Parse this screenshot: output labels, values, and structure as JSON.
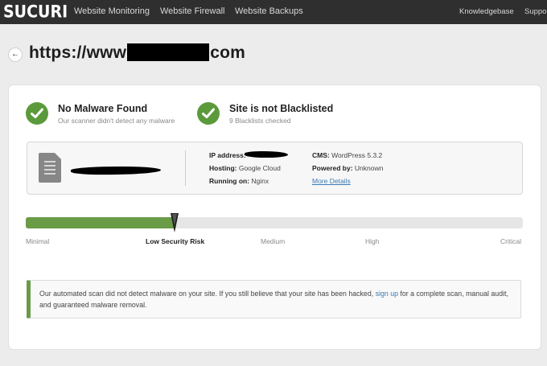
{
  "nav": {
    "logo": "SUCURI",
    "items": [
      "Website Monitoring",
      "Website Firewall",
      "Website Backups"
    ],
    "right_items": [
      "Knowledgebase",
      "Suppor"
    ]
  },
  "header": {
    "url_prefix": "https://www",
    "url_suffix": "com"
  },
  "status": {
    "malware": {
      "title": "No Malware Found",
      "subtitle": "Our scanner didn't detect any malware"
    },
    "blacklist": {
      "title": "Site is not Blacklisted",
      "subtitle": "9 Blacklists checked"
    }
  },
  "site_info": {
    "ip_label": "IP address:",
    "hosting_label": "Hosting:",
    "hosting_value": "Google Cloud",
    "running_label": "Running on:",
    "running_value": "Nginx",
    "cms_label": "CMS:",
    "cms_value": "WordPress 5.3.2",
    "powered_label": "Powered by:",
    "powered_value": "Unknown",
    "more_details": "More Details"
  },
  "risk": {
    "levels": [
      "Minimal",
      "Low Security Risk",
      "Medium",
      "High",
      "Critical"
    ],
    "active_level": "Low Security Risk",
    "fill_fraction": 0.3
  },
  "notice": {
    "text_before": "Our automated scan did not detect malware on your site. If you still believe that your site has been hacked, ",
    "link": "sign up",
    "text_after": " for a complete scan, manual audit, and guaranteed malware removal."
  },
  "colors": {
    "nav_bg": "#2f2f2f",
    "success_green": "#5b9a3b",
    "risk_green": "#6a9b47",
    "link_blue": "#3a7ab5"
  }
}
